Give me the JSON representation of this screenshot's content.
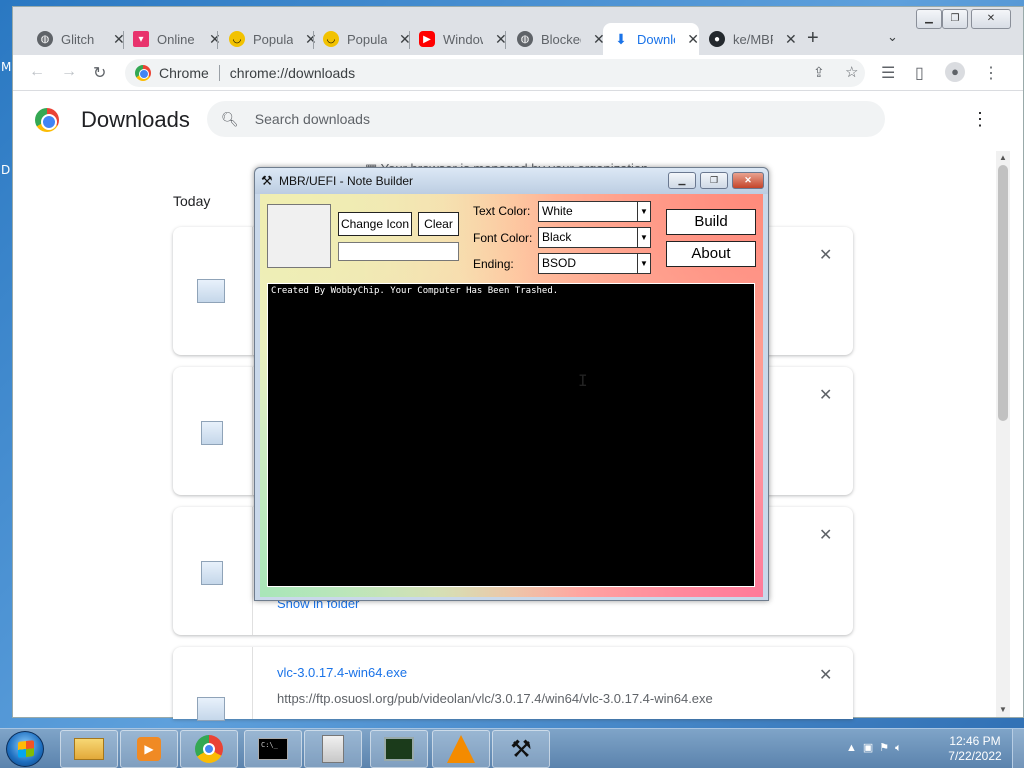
{
  "desktop": {
    "left_letter_1": "M",
    "left_letter_2": "D"
  },
  "browser": {
    "tabs": [
      {
        "title": "Glitch",
        "icon": "globe-icon",
        "color": "#5f6368"
      },
      {
        "title": "Online",
        "icon": "bookmark-icon",
        "color": "#e8336d"
      },
      {
        "title": "Popular",
        "icon": "smiley-icon",
        "color": "#f2c200"
      },
      {
        "title": "Popular",
        "icon": "smiley-icon",
        "color": "#f2c200"
      },
      {
        "title": "Windows",
        "icon": "youtube-icon",
        "color": "#ff0000"
      },
      {
        "title": "Blocked",
        "icon": "globe-icon",
        "color": "#5f6368"
      },
      {
        "title": "Downloads",
        "icon": "download-icon",
        "color": "#1a73e8",
        "active": true
      },
      {
        "title": "ke/MBR",
        "icon": "github-icon",
        "color": "#24292e"
      }
    ],
    "new_tab": "+",
    "omnibox": {
      "site": "Chrome",
      "url": "chrome://downloads"
    }
  },
  "downloads": {
    "title": "Downloads",
    "search_placeholder": "Search downloads",
    "managed_notice": "Your browser is managed by your organization",
    "section_today": "Today",
    "items": [
      {
        "name": "",
        "url": "",
        "show_in_folder": ""
      },
      {
        "name": "",
        "url": "",
        "show_in_folder": ""
      },
      {
        "name": "",
        "url": "",
        "show_in_folder": "Show in folder"
      },
      {
        "name": "vlc-3.0.17.4-win64.exe",
        "url": "https://ftp.osuosl.org/pub/videolan/vlc/3.0.17.4/win64/vlc-3.0.17.4-win64.exe",
        "show_in_folder": ""
      }
    ]
  },
  "note_builder": {
    "title": "MBR/UEFI - Note Builder",
    "change_icon_label": "Change Icon",
    "clear_label": "Clear",
    "text_color_label": "Text Color:",
    "text_color_value": "White",
    "font_color_label": "Font Color:",
    "font_color_value": "Black",
    "ending_label": "Ending:",
    "ending_value": "BSOD",
    "build_label": "Build",
    "about_label": "About",
    "note_text": "Created By WobbyChip. Your Computer Has Been Trashed."
  },
  "taskbar": {
    "apps": [
      "explorer-icon",
      "media-player-icon",
      "chrome-icon",
      "cmd-icon",
      "calculator-icon",
      "task-manager-icon",
      "vlc-icon",
      "note-builder-icon"
    ],
    "time": "12:46 PM",
    "date": "7/22/2022"
  }
}
